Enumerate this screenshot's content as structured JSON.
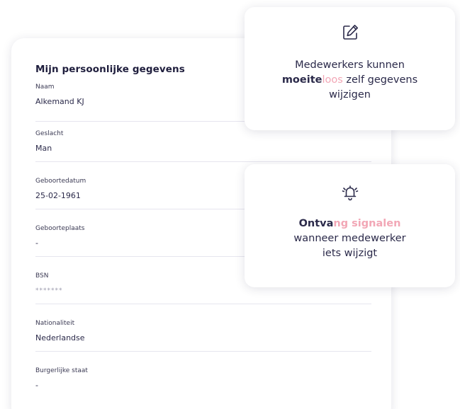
{
  "profile": {
    "title": "Mijn persoonlijke gegevens",
    "fields": [
      {
        "label": "Naam",
        "value": "Alkemand KJ"
      },
      {
        "label": "Geslacht",
        "value": "Man"
      },
      {
        "label": "Geboortedatum",
        "value": "25-02-1961"
      },
      {
        "label": "Geboorteplaats",
        "value": "-"
      },
      {
        "label": "BSN",
        "value": "*******"
      },
      {
        "label": "Nationaliteit",
        "value": "Nederlandse"
      },
      {
        "label": "Burgerlijke staat",
        "value": "-"
      }
    ]
  },
  "callouts": {
    "edit": {
      "icon": "edit-icon",
      "line1": "Medewerkers kunnen",
      "strong_part": "moeite",
      "pink_part": "loos",
      "rest_line2": " zelf gegevens",
      "line3": "wijzigen"
    },
    "signal": {
      "icon": "alarm-bell-icon",
      "strong_part": "Ontva",
      "pink_part": "ng signalen",
      "line2": "wanneer medewerker",
      "line3": "iets wijzigt"
    }
  },
  "colors": {
    "text_dark": "#2b2a4a",
    "accent_pink": "#f2a7b6",
    "divider": "#e6e5ee"
  }
}
